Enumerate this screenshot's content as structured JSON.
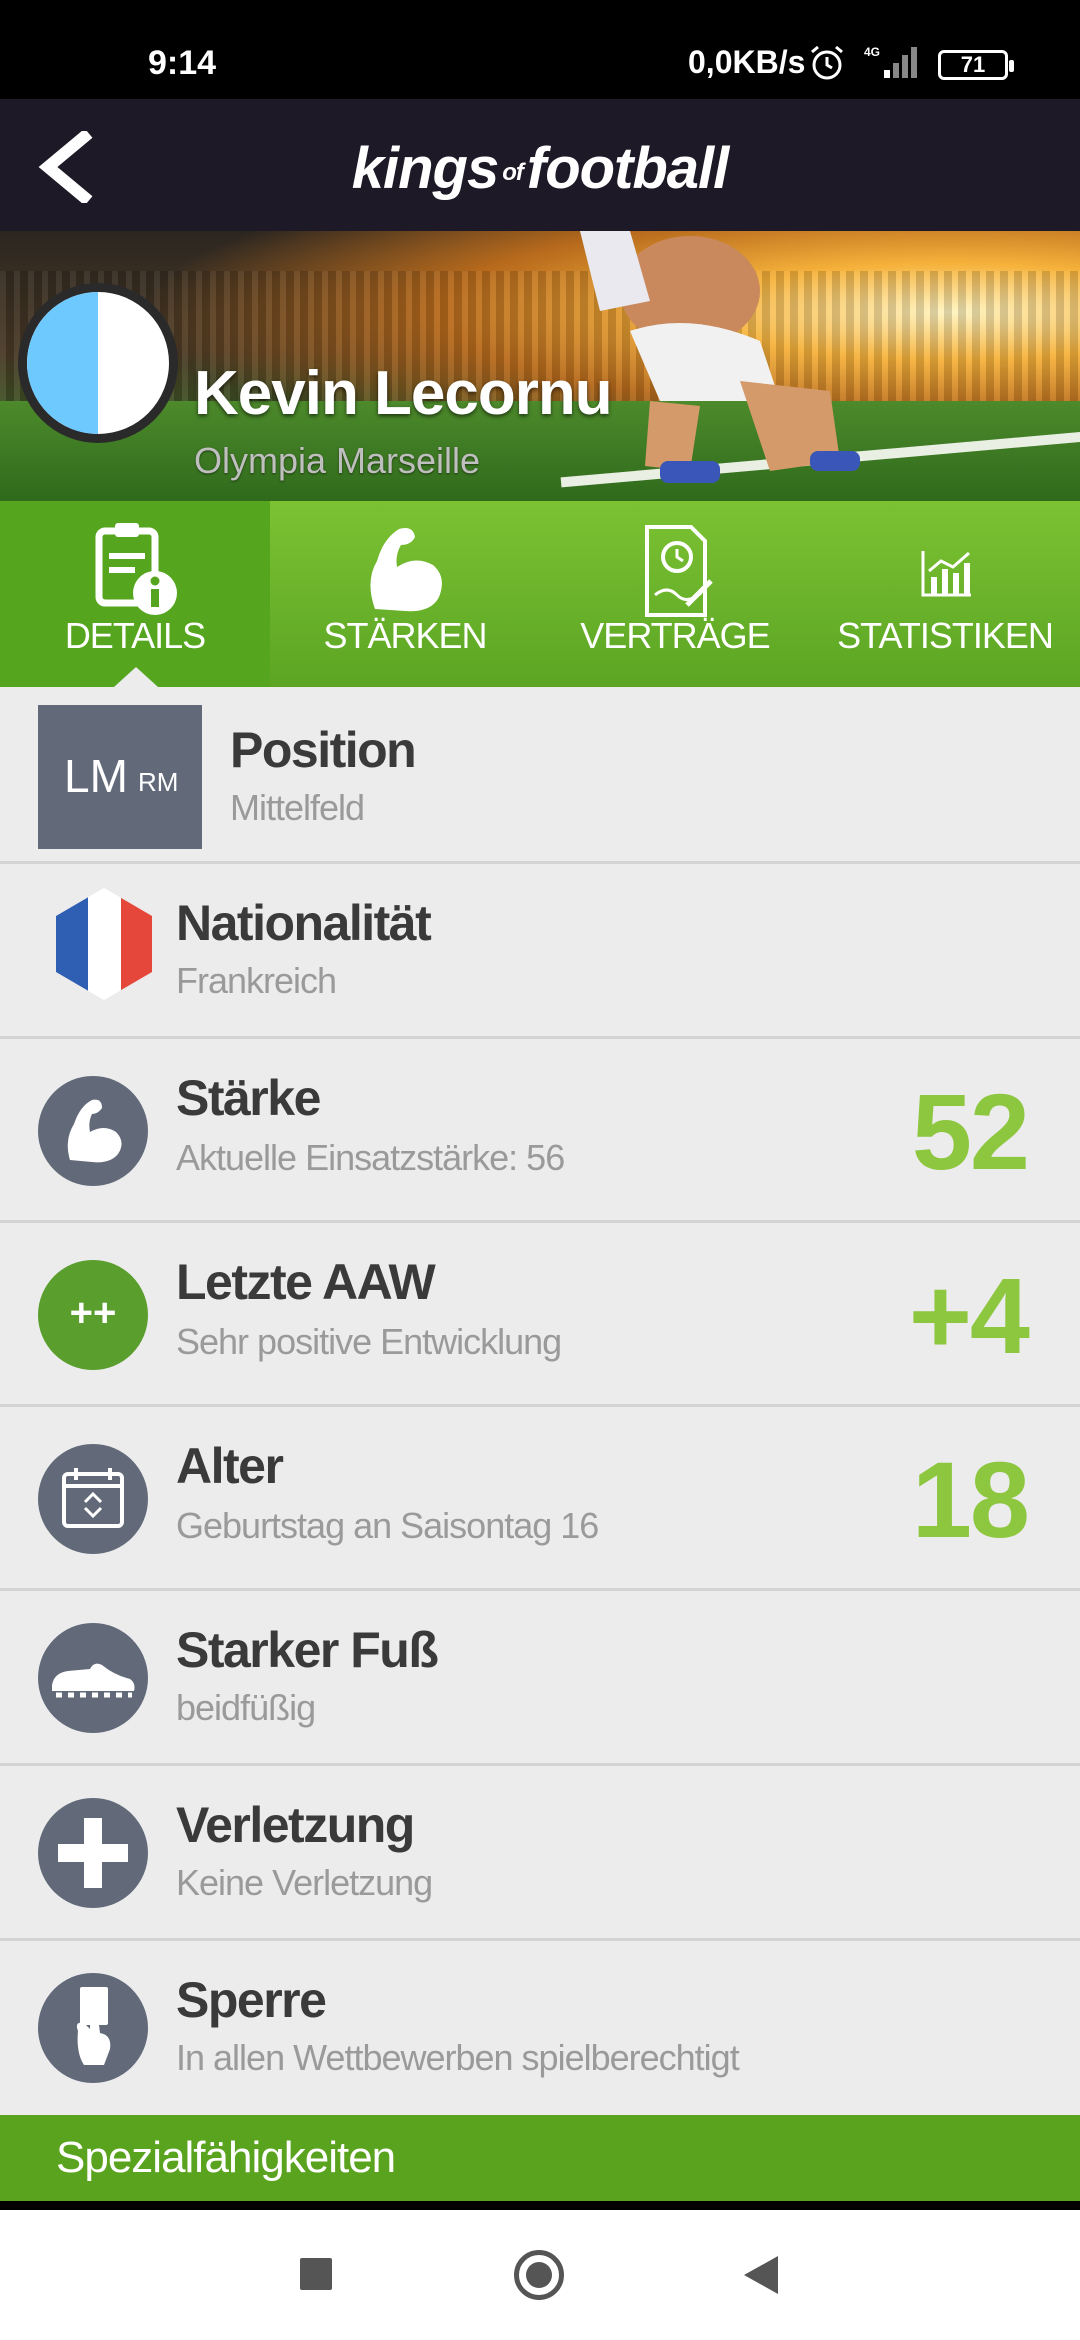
{
  "status_bar": {
    "time": "9:14",
    "network_speed": "0,0KB/s",
    "network_type": "4G",
    "battery": "71"
  },
  "app": {
    "logo_left": "kings",
    "logo_of": "of",
    "logo_right": "football",
    "back_icon": "chevron-left-icon"
  },
  "player": {
    "name": "Kevin Lecornu",
    "club": "Olympia Marseille",
    "crest_colors": [
      "#6ec9ff",
      "#ffffff"
    ]
  },
  "tabs": [
    {
      "label": "DETAILS",
      "icon": "clipboard-info-icon",
      "active": true
    },
    {
      "label": "STÄRKEN",
      "icon": "flexed-arm-icon",
      "active": false
    },
    {
      "label": "VERTRÄGE",
      "icon": "contract-icon",
      "active": false
    },
    {
      "label": "STATISTIKEN",
      "icon": "bar-chart-icon",
      "active": false
    }
  ],
  "details": {
    "position": {
      "title": "Position",
      "subtitle": "Mittelfeld",
      "primary": "LM",
      "secondary": "RM"
    },
    "nationality": {
      "title": "Nationalität",
      "subtitle": "Frankreich",
      "icon": "france-flag-icon"
    },
    "strength": {
      "title": "Stärke",
      "subtitle": "Aktuelle Einsatzstärke: 56",
      "value": "52",
      "icon": "flexed-arm-icon"
    },
    "last_aaw": {
      "title": "Letzte AAW",
      "subtitle": "Sehr positive Entwicklung",
      "value": "+4",
      "badge": "++"
    },
    "age": {
      "title": "Alter",
      "subtitle": "Geburtstag an Saisontag 16",
      "value": "18",
      "icon": "calendar-icon"
    },
    "foot": {
      "title": "Starker Fuß",
      "subtitle": "beidfüßig",
      "icon": "football-boot-icon"
    },
    "injury": {
      "title": "Verletzung",
      "subtitle": "Keine Verletzung",
      "icon": "medical-cross-icon"
    },
    "suspension": {
      "title": "Sperre",
      "subtitle": "In allen Wettbewerben spielberechtigt",
      "icon": "referee-card-icon"
    }
  },
  "section": {
    "special_abilities": "Spezialfähigkeiten"
  },
  "colors": {
    "accent_green": "#8dc63f",
    "tab_green": "#6db52a",
    "header_dark": "#1e1926",
    "icon_gray": "#626a7a"
  }
}
